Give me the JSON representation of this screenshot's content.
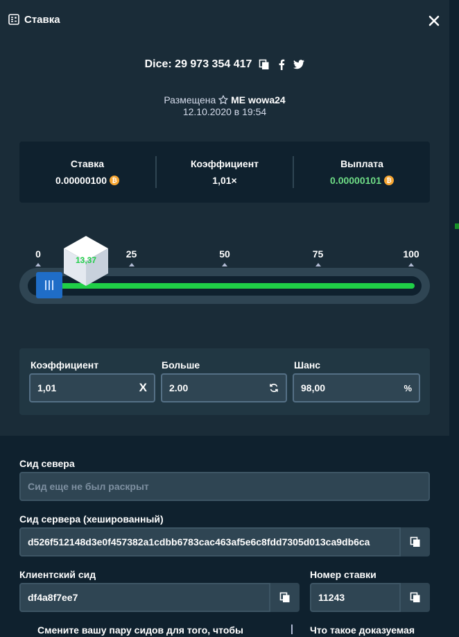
{
  "modal": {
    "title": "Ставка"
  },
  "game": {
    "id_text": "Dice: 29 973 354 417"
  },
  "placed": {
    "prefix": "Размещена",
    "user": "ME wowa24",
    "datetime": "12.10.2020 в 19:54"
  },
  "stats": {
    "bet_label": "Ставка",
    "bet_value": "0.00000100",
    "multiplier_label": "Коэффициент",
    "multiplier_value": "1,01×",
    "payout_label": "Выплата",
    "payout_value": "0.00000101",
    "payout_color": "#6fdd86",
    "coin_symbol": "₿"
  },
  "slider": {
    "ticks": [
      "0",
      "25",
      "50",
      "75",
      "100"
    ],
    "roll_result": "13,37",
    "target": 2,
    "accent_win": "#1fcf47",
    "accent_lose": "#ff4e4e"
  },
  "params": {
    "multiplier_label": "Коэффициент",
    "multiplier_value": "1,01",
    "multiplier_suffix": "X",
    "rollover_label": "Больше",
    "rollover_value": "2.00",
    "chance_label": "Шанс",
    "chance_value": "98,00",
    "chance_suffix": "%"
  },
  "fairness": {
    "server_seed_label": "Сид севера",
    "server_seed_placeholder": "Сид еще не был раскрыт",
    "hashed_seed_label": "Сид сервера (хешированный)",
    "hashed_seed_value": "d526f512148d3e0f457382a1cdbb6783cac463af5e6c8fdd7305d013ca9db6ca",
    "client_seed_label": "Клиентский сид",
    "client_seed_value": "df4a8f7ee7",
    "nonce_label": "Номер ставки",
    "nonce_value": "11243",
    "change_seed_text": "Смените вашу пару сидов для того, чтобы",
    "provably_fair_text": "Что такое доказуемая"
  },
  "icons": {
    "header": "dice-sheet-icon",
    "close": "close-icon",
    "copy": "copy-icon",
    "facebook": "facebook-icon",
    "twitter": "twitter-icon",
    "star": "star-icon",
    "refresh": "refresh-icon"
  }
}
